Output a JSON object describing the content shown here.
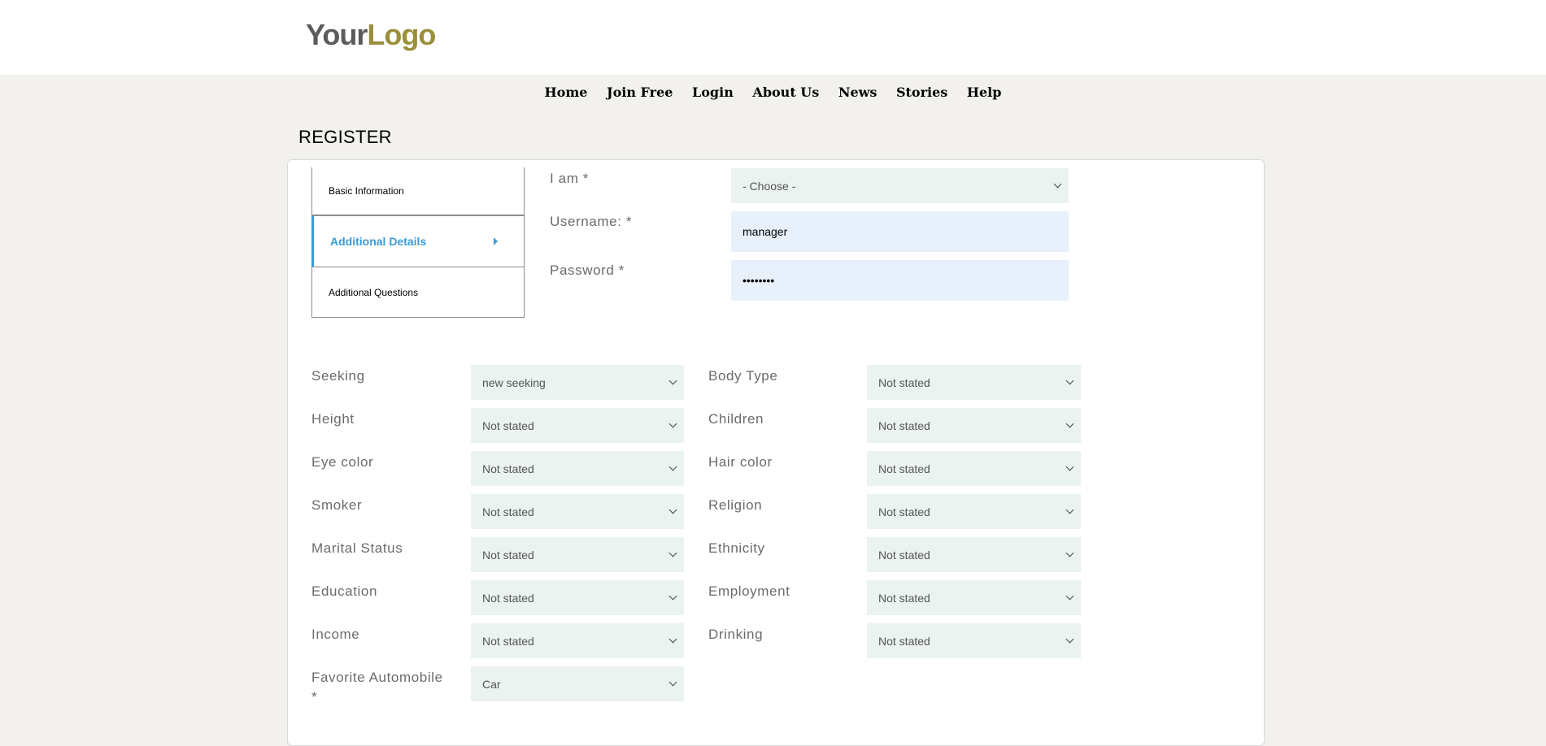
{
  "logo": {
    "part1": "Your",
    "part2": "Logo"
  },
  "nav": {
    "items": [
      "Home",
      "Join Free",
      "Login",
      "About Us",
      "News",
      "Stories",
      "Help"
    ]
  },
  "page": {
    "title": "REGISTER"
  },
  "steps": {
    "items": [
      "Basic Information",
      "Additional Details",
      "Additional Questions"
    ],
    "active": "Additional Details"
  },
  "account": {
    "iam_label": "I am *",
    "iam_value": "- Choose -",
    "username_label": "Username: *",
    "username_value": "manager",
    "password_label": "Password *",
    "password_value": "••••••••"
  },
  "fields": {
    "seeking": {
      "label": "Seeking",
      "value": "new seeking"
    },
    "body_type": {
      "label": "Body Type",
      "value": "Not stated"
    },
    "height": {
      "label": "Height",
      "value": "Not stated"
    },
    "children": {
      "label": "Children",
      "value": "Not stated"
    },
    "eye_color": {
      "label": "Eye color",
      "value": "Not stated"
    },
    "hair_color": {
      "label": "Hair color",
      "value": "Not stated"
    },
    "smoker": {
      "label": "Smoker",
      "value": "Not stated"
    },
    "religion": {
      "label": "Religion",
      "value": "Not stated"
    },
    "marital_status": {
      "label": "Marital Status",
      "value": "Not stated"
    },
    "ethnicity": {
      "label": "Ethnicity",
      "value": "Not stated"
    },
    "education": {
      "label": "Education",
      "value": "Not stated"
    },
    "employment": {
      "label": "Employment",
      "value": "Not stated"
    },
    "income": {
      "label": "Income",
      "value": "Not stated"
    },
    "drinking": {
      "label": "Drinking",
      "value": "Not stated"
    },
    "favorite_automobile": {
      "label": "Favorite Automobile",
      "required_mark": "*",
      "value": "Car"
    }
  }
}
